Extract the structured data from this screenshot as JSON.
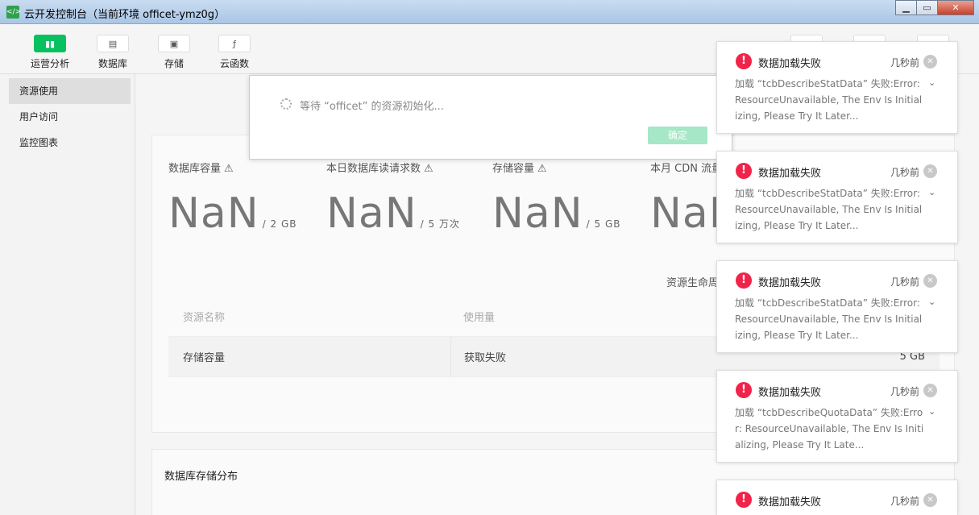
{
  "window": {
    "app_icon": "</>",
    "title": "云开发控制台（当前环境 officet-ymz0g）",
    "min_label": "▁",
    "max_label": "▭",
    "close_label": "✕"
  },
  "toolbar": {
    "items": [
      {
        "label": "运营分析",
        "icon": "chart-icon",
        "glyph": "▮▮"
      },
      {
        "label": "数据库",
        "icon": "database-icon",
        "glyph": "▤"
      },
      {
        "label": "存储",
        "icon": "storage-icon",
        "glyph": "▣"
      },
      {
        "label": "云函数",
        "icon": "function-icon",
        "glyph": "ƒ"
      }
    ]
  },
  "sidebar": {
    "items": [
      {
        "label": "资源使用"
      },
      {
        "label": "用户访问"
      },
      {
        "label": "监控图表"
      }
    ]
  },
  "stats": [
    {
      "label": "数据库容量",
      "value": "NaN",
      "unit": "/ 2 GB"
    },
    {
      "label": "本日数据库读请求数",
      "value": "NaN",
      "unit": "/ 5 万次"
    },
    {
      "label": "存储容量",
      "value": "NaN",
      "unit": "/ 5 GB"
    },
    {
      "label": "本月 CDN 流量",
      "value": "NaN",
      "unit": ""
    }
  ],
  "lifecycle_label": "资源生命周",
  "table": {
    "headers": [
      "资源名称",
      "使用量",
      ""
    ],
    "rows": [
      {
        "name": "存储容量",
        "usage": "获取失败",
        "quota": "5 GB"
      }
    ]
  },
  "section2_title": "数据库存储分布",
  "dialog": {
    "message": "等待 “officet” 的资源初始化...",
    "ok_label": "确定"
  },
  "toasts": [
    {
      "title": "数据加载失败",
      "time": "几秒前",
      "body": "加载 “tcbDescribeStatData” 失败:Error: ResourceUnavailable, The Env Is Initializing, Please Try It Later..."
    },
    {
      "title": "数据加载失败",
      "time": "几秒前",
      "body": "加载 “tcbDescribeStatData” 失败:Error: ResourceUnavailable, The Env Is Initializing, Please Try It Later..."
    },
    {
      "title": "数据加载失败",
      "time": "几秒前",
      "body": "加载 “tcbDescribeStatData” 失败:Error: ResourceUnavailable, The Env Is Initializing, Please Try It Later..."
    },
    {
      "title": "数据加载失败",
      "time": "几秒前",
      "body": "加载 “tcbDescribeQuotaData” 失败:Error: ResourceUnavailable, The Env Is Initializing, Please Try It Late..."
    },
    {
      "title": "数据加载失败",
      "time": "几秒前",
      "body": ""
    }
  ],
  "colors": {
    "accent": "#07c160",
    "error": "#f0244a"
  }
}
